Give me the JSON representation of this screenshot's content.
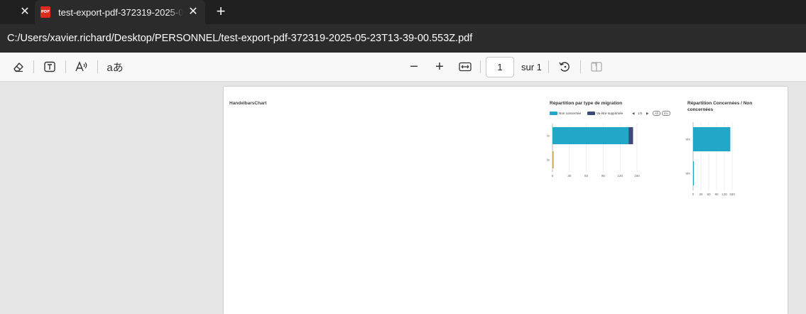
{
  "tabs": {
    "active_title": "test-export-pdf-372319-2025-05-23T13-39-00.553Z.pdf",
    "pdf_badge": "PDF",
    "close_glyph": "✕",
    "new_tab_glyph": "+"
  },
  "address": {
    "path": "C:/Users/xavier.richard/Desktop/PERSONNEL/test-export-pdf-372319-2025-05-23T13-39-00.553Z.pdf"
  },
  "toolbar": {
    "icons": [
      "eraser-icon",
      "text-box-icon",
      "read-aloud-icon",
      "translate-icon",
      "zoom-out-icon",
      "zoom-in-icon",
      "fit-width-icon",
      "rotate-icon",
      "two-page-icon"
    ],
    "zoom_out_glyph": "−",
    "zoom_in_glyph": "+",
    "translate_glyph": "aあ",
    "page_current": "1",
    "page_total": "sur 1"
  },
  "document": {
    "title": "HandelbarsChart",
    "legend_nav": "1/5",
    "legend_all": "All",
    "legend_inv": "Inv"
  },
  "colors": {
    "teal": "#23a7c9",
    "navy": "#3c4a7a",
    "gold": "#c9a24a"
  },
  "chart_data": [
    {
      "type": "bar",
      "orientation": "horizontal",
      "stacked": true,
      "title": "Répartition par type de migration",
      "categories": [
        "Non concernée",
        "Réalisable"
      ],
      "series": [
        {
          "name": "Non concernée",
          "color": "#23a7c9",
          "values": [
            135,
            0
          ]
        },
        {
          "name": "Va être supprimée",
          "color": "#3c4a7a",
          "values": [
            8,
            0
          ]
        },
        {
          "color": "#c9a24a",
          "values": [
            0,
            2
          ]
        }
      ],
      "xticks": [
        "0",
        "30",
        "60",
        "90",
        "120",
        "150"
      ],
      "xlim": [
        0,
        150
      ],
      "legend_position": "top",
      "grid": true
    },
    {
      "type": "bar",
      "orientation": "horizontal",
      "title": "Répartition Concernées / Non concernées",
      "categories": [
        "Non concernée",
        "Concernée"
      ],
      "series": [
        {
          "color": "#23a7c9",
          "values": [
            143,
            1
          ]
        }
      ],
      "xticks": [
        "0",
        "30",
        "60",
        "90",
        "120",
        "150"
      ],
      "xlim": [
        0,
        150
      ],
      "grid": true
    }
  ]
}
